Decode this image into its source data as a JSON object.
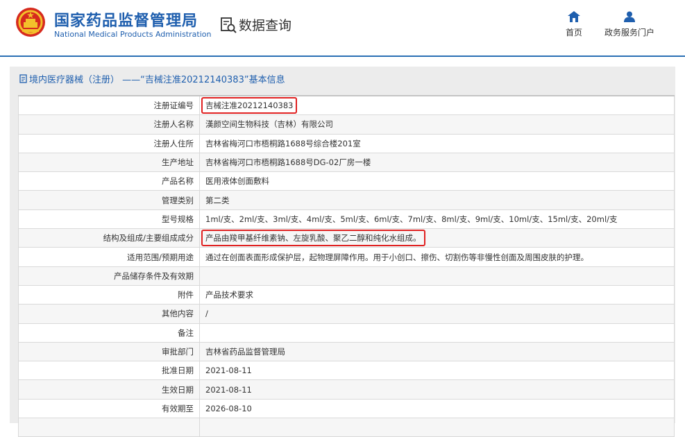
{
  "header": {
    "org_name_cn": "国家药品监督管理局",
    "org_name_en": "National Medical Products Administration",
    "query_label": "数据查询",
    "nav": [
      {
        "label": "首页",
        "icon": "home-icon"
      },
      {
        "label": "政务服务门户",
        "icon": "user-icon"
      }
    ]
  },
  "panel": {
    "title": "境内医疗器械（注册） ——“吉械注准20212140383”基本信息"
  },
  "table": {
    "rows": [
      {
        "label": "注册证编号",
        "value": "吉械注准20212140383",
        "highlighted": true
      },
      {
        "label": "注册人名称",
        "value": "漢颜空间生物科技（吉林）有限公司"
      },
      {
        "label": "注册人住所",
        "value": "吉林省梅河口市梧桐路1688号综合楼201室"
      },
      {
        "label": "生产地址",
        "value": "吉林省梅河口市梧桐路1688号DG-02厂房一楼"
      },
      {
        "label": "产品名称",
        "value": "医用液体创面敷料"
      },
      {
        "label": "管理类别",
        "value": "第二类"
      },
      {
        "label": "型号规格",
        "value": "1ml/支、2ml/支、3ml/支、4ml/支、5ml/支、6ml/支、7ml/支、8ml/支、9ml/支、10ml/支、15ml/支、20ml/支"
      },
      {
        "label": "结构及组成/主要组成成分",
        "value": "产品由羧甲基纤维素钠、左旋乳酸、聚乙二醇和纯化水组成。",
        "highlighted": true
      },
      {
        "label": "适用范围/预期用途",
        "value": "通过在创面表面形成保护层，起物理屏障作用。用于小创口、擦伤、切割伤等非慢性创面及周围皮肤的护理。"
      },
      {
        "label": "产品储存条件及有效期",
        "value": ""
      },
      {
        "label": "附件",
        "value": "产品技术要求"
      },
      {
        "label": "其他内容",
        "value": "/"
      },
      {
        "label": "备注",
        "value": ""
      },
      {
        "label": "审批部门",
        "value": "吉林省药品监督管理局"
      },
      {
        "label": "批准日期",
        "value": "2021-08-11"
      },
      {
        "label": "生效日期",
        "value": "2021-08-11"
      },
      {
        "label": "有效期至",
        "value": "2026-08-10"
      },
      {
        "label": "",
        "value": ""
      }
    ]
  },
  "colors": {
    "brand_blue": "#1f5fae",
    "highlight_red": "#e02020",
    "panel_gray": "#ececec"
  }
}
